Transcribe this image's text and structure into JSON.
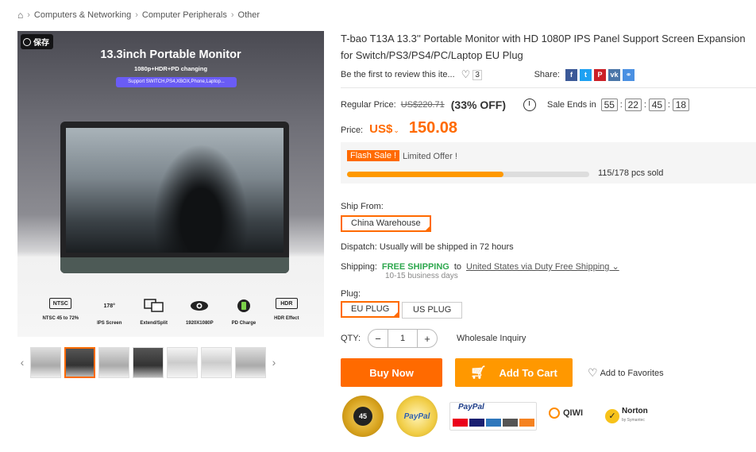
{
  "breadcrumb": {
    "items": [
      "Computers & Networking",
      "Computer Peripherals",
      "Other"
    ]
  },
  "gallery": {
    "save_label": "保存",
    "hero_title": "13.3inch Portable Monitor",
    "hero_subtitle": "1080p+HDR+PD changing",
    "hero_pill": "Support SWITCH,PS4,XBOX,Phone,Laptop...",
    "features": [
      {
        "icon": "NTSC",
        "label": "NTSC 45 to 72%"
      },
      {
        "icon": "178°",
        "label": "IPS Screen"
      },
      {
        "icon": "",
        "label": "Extend/Split"
      },
      {
        "icon": "",
        "label": "1920X1080P"
      },
      {
        "icon": "",
        "label": "PD Charge"
      },
      {
        "icon": "HDR",
        "label": "HDR Effect"
      }
    ],
    "prev_arrow": "‹",
    "next_arrow": "›"
  },
  "product": {
    "title": "T-bao T13A 13.3'' Portable Monitor with HD 1080P IPS Panel Support Screen Expansion for Switch/PS3/PS4/PC/Laptop EU Plug",
    "review_text": "Be the first to review this ite...",
    "wish_count": "3",
    "share_label": "Share:"
  },
  "pricing": {
    "regular_label": "Regular Price:",
    "regular_value": "US$220.71",
    "discount": "(33% OFF)",
    "sale_ends_label": "Sale Ends in",
    "timer": [
      "55",
      "22",
      "45",
      "18"
    ],
    "price_label": "Price:",
    "currency": "US$",
    "price_value": "150.08"
  },
  "flash": {
    "badge": "Flash Sale !",
    "offer": "Limited Offer !",
    "sold_text": "115/178 pcs sold",
    "sold_fraction": 0.646
  },
  "shipping": {
    "ship_from_label": "Ship From:",
    "warehouse": "China Warehouse",
    "dispatch": "Dispatch: Usually will be shipped in 72 hours",
    "shipping_label": "Shipping:",
    "free": "FREE SHIPPING",
    "to": "to",
    "destination": "United States via Duty Free Shipping",
    "days": "10-15 business days"
  },
  "plug": {
    "label": "Plug:",
    "options": [
      "EU PLUG",
      "US PLUG"
    ],
    "selected": "EU PLUG"
  },
  "quantity": {
    "label": "QTY:",
    "minus": "−",
    "value": "1",
    "plus": "+",
    "wholesale": "Wholesale Inquiry"
  },
  "actions": {
    "buy_now": "Buy Now",
    "add_to_cart": "Add To Cart",
    "add_to_favorites": "Add to Favorites"
  },
  "badges": {
    "money_back_days": "45",
    "paypal_verified": "PayPal",
    "paypal_text": "PayPal",
    "qiwi": "QIWI",
    "norton": "Norton",
    "norton_sub": "by Symantec"
  },
  "colors": {
    "accent": "#ff6a00",
    "cart": "#ff9800",
    "free_shipping": "#2fa84f",
    "facebook": "#3b5998",
    "twitter": "#1da1f2",
    "pinterest": "#cb2027",
    "vk": "#4a76a8",
    "link": "#4a90e2"
  }
}
